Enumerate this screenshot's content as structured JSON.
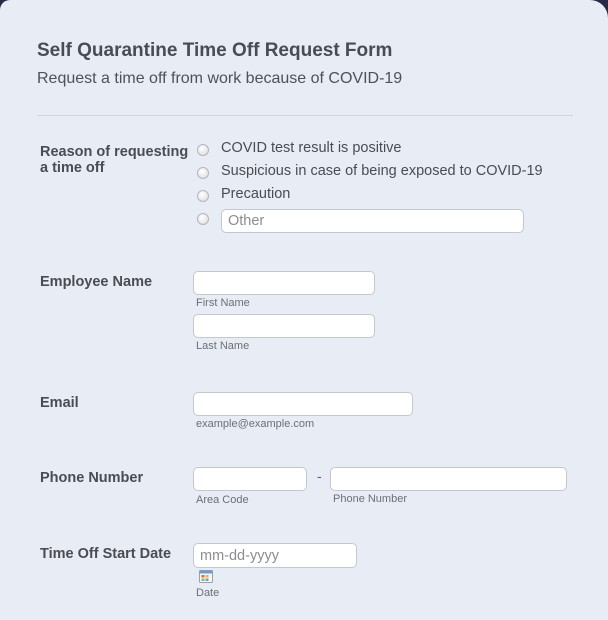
{
  "form": {
    "title": "Self Quarantine Time Off Request Form",
    "subtitle": "Request a time off from work because of COVID-19"
  },
  "reason": {
    "label": "Reason of requesting a time off",
    "options": [
      "COVID test result is positive",
      "Suspicious in case of being exposed to COVID-19",
      "Precaution"
    ],
    "other_placeholder": "Other"
  },
  "employee_name": {
    "label": "Employee Name",
    "first_name_value": "",
    "first_name_sublabel": "First Name",
    "last_name_value": "",
    "last_name_sublabel": "Last Name"
  },
  "email": {
    "label": "Email",
    "value": "",
    "sublabel": "example@example.com"
  },
  "phone": {
    "label": "Phone Number",
    "area_code_value": "",
    "area_code_sublabel": "Area Code",
    "separator": "-",
    "number_value": "",
    "number_sublabel": "Phone Number"
  },
  "start_date": {
    "label": "Time Off Start Date",
    "placeholder": "mm-dd-yyyy",
    "sublabel": "Date",
    "icon": "calendar-icon"
  }
}
